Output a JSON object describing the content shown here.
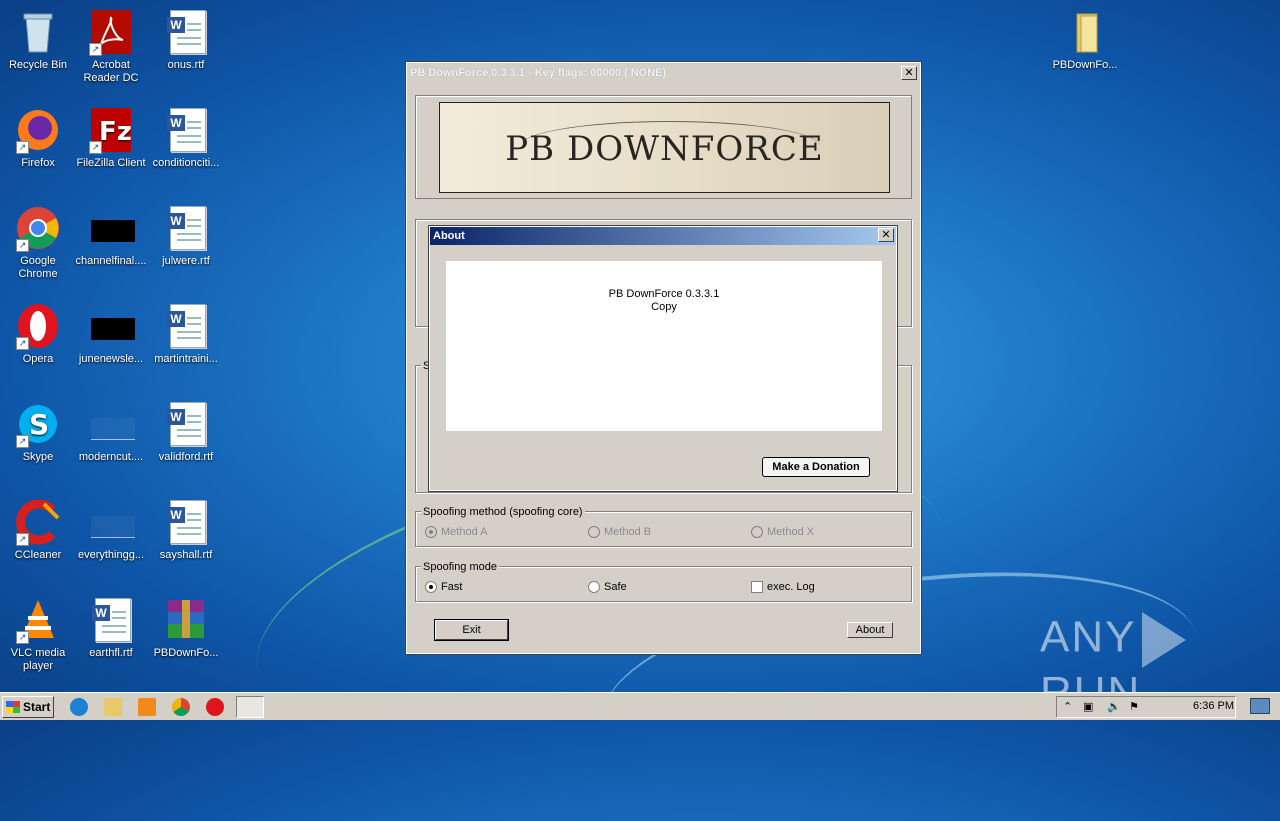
{
  "desktop": {
    "icons": [
      {
        "label": "Recycle Bin",
        "icon": "recycle-bin-icon"
      },
      {
        "label": "Acrobat Reader DC",
        "icon": "acrobat-icon"
      },
      {
        "label": "onus.rtf",
        "icon": "word-doc-icon"
      },
      {
        "label": "Firefox",
        "icon": "firefox-icon"
      },
      {
        "label": "FileZilla Client",
        "icon": "filezilla-icon"
      },
      {
        "label": "conditionciti...",
        "icon": "word-doc-icon"
      },
      {
        "label": "Google Chrome",
        "icon": "chrome-icon"
      },
      {
        "label": "channelfinal....",
        "icon": "black-file-icon"
      },
      {
        "label": "julwere.rtf",
        "icon": "word-doc-icon"
      },
      {
        "label": "Opera",
        "icon": "opera-icon"
      },
      {
        "label": "junenewsle...",
        "icon": "black-file-icon"
      },
      {
        "label": "martintraini...",
        "icon": "word-doc-icon"
      },
      {
        "label": "Skype",
        "icon": "skype-icon"
      },
      {
        "label": "moderncut....",
        "icon": "blank-file-icon"
      },
      {
        "label": "validford.rtf",
        "icon": "word-doc-icon"
      },
      {
        "label": "CCleaner",
        "icon": "ccleaner-icon"
      },
      {
        "label": "everythingg...",
        "icon": "blank-file-icon"
      },
      {
        "label": "sayshall.rtf",
        "icon": "word-doc-icon"
      },
      {
        "label": "VLC media player",
        "icon": "vlc-icon"
      },
      {
        "label": "earthfl.rtf",
        "icon": "word-doc-icon"
      },
      {
        "label": "PBDownFo...",
        "icon": "winrar-icon"
      },
      {
        "label": "PBDownFo...",
        "icon": "folder-icon"
      }
    ]
  },
  "main_window": {
    "title": "PB DownForce 0.3.3.1  -  Key flags: 00000 ( NONE)",
    "banner_text": "PB DOWNFORCE",
    "spoofing_method": {
      "label": "Spoofing method (spoofing core)",
      "options": [
        "Method A",
        "Method B",
        "Method X"
      ],
      "selected": "Method A"
    },
    "spoofing_mode": {
      "label": "Spoofing mode",
      "options": [
        "Fast",
        "Safe"
      ],
      "selected": "Fast",
      "exec_log_label": "exec. Log",
      "exec_log_checked": false
    },
    "exit_label": "Exit",
    "about_label": "About",
    "partial_label": "S"
  },
  "about_dialog": {
    "title": "About",
    "line1": "PB DownForce 0.3.3.1",
    "line2": "Copy",
    "donate_label": "Make a Donation"
  },
  "taskbar": {
    "start_label": "Start",
    "clock": "6:36 PM"
  },
  "watermark": {
    "left": "ANY",
    "right": "RUN"
  }
}
